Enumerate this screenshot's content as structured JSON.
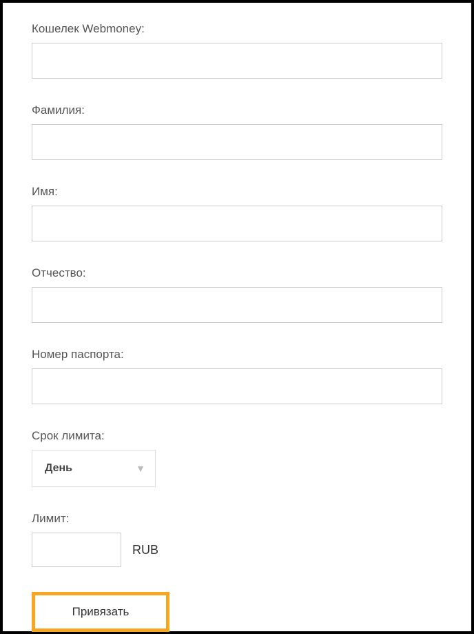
{
  "fields": {
    "wallet": {
      "label": "Кошелек Webmoney:",
      "value": ""
    },
    "lastname": {
      "label": "Фамилия:",
      "value": ""
    },
    "firstname": {
      "label": "Имя:",
      "value": ""
    },
    "middlename": {
      "label": "Отчество:",
      "value": ""
    },
    "passport": {
      "label": "Номер паспорта:",
      "value": ""
    },
    "limitPeriod": {
      "label": "Срок лимита:",
      "selected": "День"
    },
    "limit": {
      "label": "Лимит:",
      "value": "",
      "currency": "RUB"
    }
  },
  "buttons": {
    "submit": "Привязать"
  }
}
